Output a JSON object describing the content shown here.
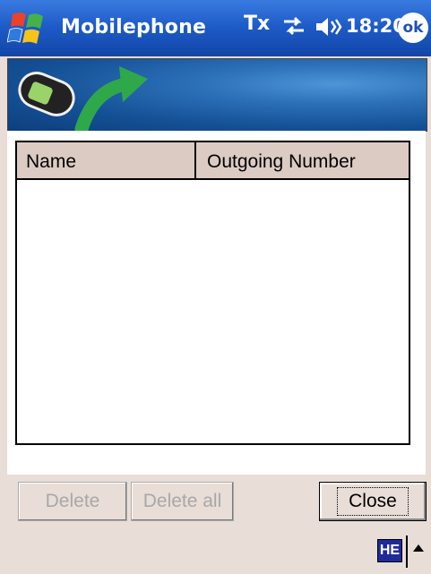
{
  "titlebar": {
    "title": "Mobilephone",
    "tx_icon": "Tx",
    "clock": "18:20",
    "ok_label": "ok",
    "icons": [
      "windows-start-icon",
      "tx-icon",
      "sync-icon",
      "volume-icon"
    ],
    "color": "#1e5cc8"
  },
  "list": {
    "columns": [
      "Name",
      "Outgoing Number"
    ],
    "rows": []
  },
  "buttons": {
    "delete_label": "Delete",
    "delete_all_label": "Delete all",
    "close_label": "Close"
  },
  "input_panel": {
    "ime_label": "HE"
  },
  "banner": {
    "icons": [
      "cellphone-icon",
      "outgoing-arrow-icon"
    ]
  }
}
